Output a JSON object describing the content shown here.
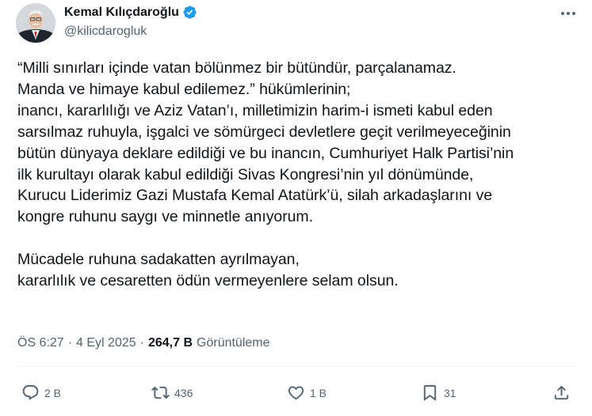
{
  "author": {
    "name": "Kemal Kılıçdaroğlu",
    "handle": "@kilicdarogluk",
    "avatar_icon": "avatar",
    "verified_icon": "verified-badge-icon",
    "verified_color": "#1d9bf0"
  },
  "tweet": {
    "text": "“Milli sınırları içinde vatan bölünmez bir bütündür, parçalanamaz.\nManda ve himaye kabul edilemez.” hükümlerinin;\ninancı, kararlılığı ve Aziz Vatan’ı, milletimizin harim-i ismeti kabul eden\nsarsılmaz ruhuyla, işgalci ve sömürgeci devletlere geçit verilmeyeceğinin\nbütün dünyaya deklare edildiği ve bu inancın, Cumhuriyet Halk Partisi’nin\nilk kurultayı olarak kabul edildiği Sivas Kongresi’nin yıl dönümünde,\nKurucu Liderimiz Gazi Mustafa Kemal Atatürk’ü, silah arkadaşlarını ve\nkongre ruhunu saygı ve minnetle anıyorum.\n\nMücadele ruhuna sadakatten ayrılmayan,\nkararlılık ve cesaretten ödün vermeyenlere selam olsun."
  },
  "meta": {
    "time": "ÖS 6:27",
    "sep1": "·",
    "date": "4 Eyl 2025",
    "sep2": "·",
    "views": "264,7 B",
    "views_label": "Görüntüleme"
  },
  "actions": {
    "reply": {
      "icon": "reply-icon",
      "count": "2 B"
    },
    "retweet": {
      "icon": "retweet-icon",
      "count": "436"
    },
    "like": {
      "icon": "heart-icon",
      "count": "1 B"
    },
    "bookmark": {
      "icon": "bookmark-icon",
      "count": "31"
    },
    "share": {
      "icon": "share-icon"
    }
  },
  "colors": {
    "text": "#0f1419",
    "secondary": "#536471",
    "accent": "#1d9bf0"
  }
}
